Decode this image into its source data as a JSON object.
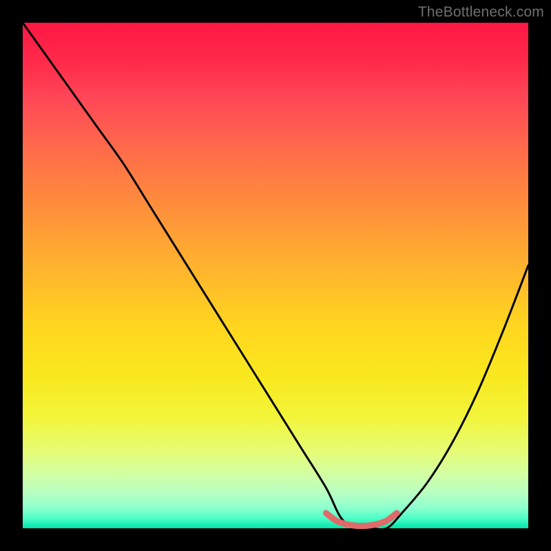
{
  "watermark": "TheBottleneck.com",
  "chart_data": {
    "type": "line",
    "title": "",
    "xlabel": "",
    "ylabel": "",
    "xlim": [
      0,
      100
    ],
    "ylim": [
      0,
      100
    ],
    "grid": false,
    "series": [
      {
        "name": "bottleneck-curve",
        "color": "#000000",
        "x": [
          0,
          5,
          10,
          15,
          20,
          25,
          30,
          35,
          40,
          45,
          50,
          55,
          60,
          63,
          66,
          69,
          72,
          75,
          80,
          85,
          90,
          95,
          100
        ],
        "values": [
          100,
          93,
          86,
          79,
          72,
          64,
          56,
          48,
          40,
          32,
          24,
          16,
          8,
          2,
          0,
          0,
          0,
          3,
          9,
          17,
          27,
          39,
          52
        ]
      },
      {
        "name": "optimal-band",
        "color": "#e46a6a",
        "x": [
          60,
          62,
          64,
          66,
          68,
          70,
          72,
          74
        ],
        "values": [
          3,
          1.5,
          0.8,
          0.5,
          0.5,
          0.8,
          1.5,
          3
        ]
      }
    ],
    "optimal_range_x": [
      62,
      73
    ]
  }
}
